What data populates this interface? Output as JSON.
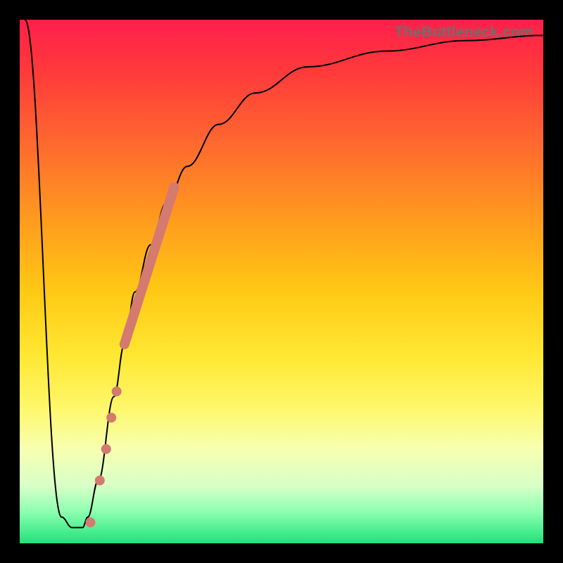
{
  "watermark": "TheBottleneck.com",
  "chart_data": {
    "type": "line",
    "title": "",
    "xlabel": "",
    "ylabel": "",
    "xlim": [
      0,
      100
    ],
    "ylim": [
      0,
      100
    ],
    "series": [
      {
        "name": "bottleneck-curve",
        "x": [
          1,
          8,
          10,
          12,
          13,
          15,
          18,
          20,
          22,
          25,
          28,
          32,
          38,
          45,
          55,
          70,
          85,
          100
        ],
        "y": [
          100,
          5,
          3,
          3,
          5,
          12,
          28,
          38,
          48,
          57,
          65,
          72,
          80,
          86,
          91,
          94,
          96,
          97
        ]
      }
    ],
    "highlight_segment": {
      "x": [
        20,
        29.5
      ],
      "y": [
        38,
        68
      ]
    },
    "highlight_points": [
      {
        "x": 15.3,
        "y": 12
      },
      {
        "x": 16.5,
        "y": 18
      },
      {
        "x": 17.5,
        "y": 24
      },
      {
        "x": 18.5,
        "y": 29
      },
      {
        "x": 13.5,
        "y": 4
      }
    ],
    "colors": {
      "curve": "#000000",
      "highlight": "#d47a6f",
      "gradient_top": "#ff1f4b",
      "gradient_bottom": "#1fe27a"
    }
  }
}
